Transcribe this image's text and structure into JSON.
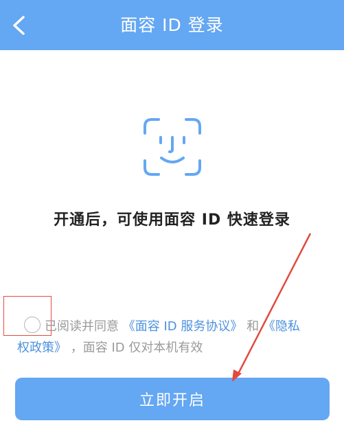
{
  "header": {
    "title": "面容 ID 登录",
    "background": "#64a7f2",
    "back_icon": "chevron-left-icon"
  },
  "main": {
    "icon": "face-id-icon",
    "headline": "开通后，可使用面容 ID 快速登录"
  },
  "consent": {
    "prefix": "已阅读并同意",
    "service_link": "《面容 ID 服务协议》",
    "conjunction": "和",
    "privacy_link_part1": "《隐私",
    "privacy_link_part2": "权政策》",
    "suffix": "，面容 ID 仅对本机有效",
    "checked": false,
    "link_color": "#4c91dc"
  },
  "button": {
    "label": "立即开启",
    "color": "#64a7f2"
  },
  "annotations": {
    "highlight_color": "#e24a3e"
  }
}
